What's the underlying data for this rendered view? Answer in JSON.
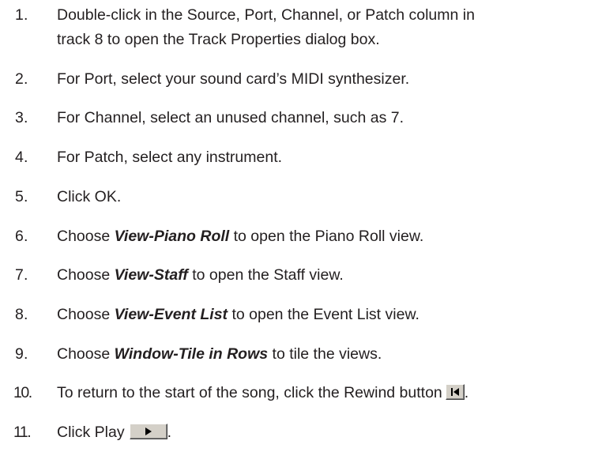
{
  "steps": [
    {
      "number": "1.",
      "line1": "Double-click in the Source, Port, Channel, or Patch column in",
      "line2": "track 8 to open the Track Properties dialog box."
    },
    {
      "number": "2.",
      "text": "For Port, select your sound card’s MIDI synthesizer."
    },
    {
      "number": "3.",
      "text": "For Channel, select an unused channel, such as 7."
    },
    {
      "number": "4.",
      "text": "For Patch, select any instrument."
    },
    {
      "number": "5.",
      "text": "Click OK."
    },
    {
      "number": "6.",
      "prefix": "Choose ",
      "command": "View-Piano Roll",
      "suffix": " to open the Piano Roll view."
    },
    {
      "number": "7.",
      "prefix": "Choose ",
      "command": "View-Staff",
      "suffix": " to open the Staff view."
    },
    {
      "number": "8.",
      "prefix": "Choose ",
      "command": "View-Event List",
      "suffix": " to open the Event List view."
    },
    {
      "number": "9.",
      "prefix": "Choose ",
      "command": "Window-Tile in Rows",
      "suffix": " to tile the views."
    },
    {
      "number": "10.",
      "text": "To return to the start of the song, click the Rewind button",
      "icon": "rewind-icon",
      "after": "."
    },
    {
      "number": "11.",
      "text": "Click Play",
      "icon": "play-icon",
      "after": "."
    }
  ]
}
